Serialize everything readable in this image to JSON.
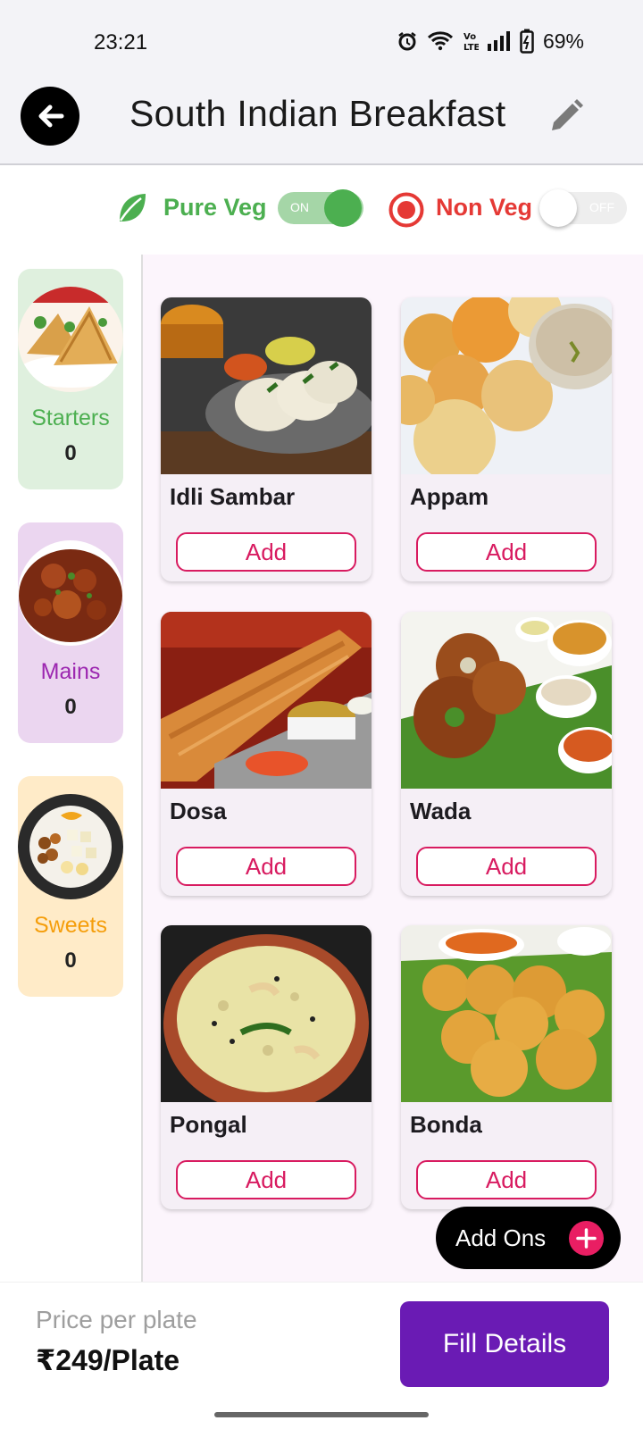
{
  "status_bar": {
    "time": "23:21",
    "battery": "69%"
  },
  "app_bar": {
    "title": "South Indian Breakfast"
  },
  "filters": {
    "veg": {
      "label": "Pure Veg",
      "state": "ON"
    },
    "nonveg": {
      "label": "Non Veg",
      "state": "OFF"
    }
  },
  "categories": [
    {
      "name": "Starters",
      "count": "0",
      "color": "#4caf50",
      "bg": "#dff0de"
    },
    {
      "name": "Mains",
      "count": "0",
      "color": "#9c27b0",
      "bg": "#ebd6f0"
    },
    {
      "name": "Sweets",
      "count": "0",
      "color": "#f59e0b",
      "bg": "#ffebc8"
    }
  ],
  "items": [
    {
      "name": "Idli Sambar",
      "add_label": "Add"
    },
    {
      "name": "Appam",
      "add_label": "Add"
    },
    {
      "name": "Dosa",
      "add_label": "Add"
    },
    {
      "name": "Wada",
      "add_label": "Add"
    },
    {
      "name": "Pongal",
      "add_label": "Add"
    },
    {
      "name": "Bonda",
      "add_label": "Add"
    }
  ],
  "add_ons": {
    "label": "Add Ons"
  },
  "footer": {
    "price_label": "Price per plate",
    "price_value": "₹249/Plate",
    "cta_label": "Fill Details"
  },
  "colors": {
    "accent": "#d81b60",
    "cta": "#6a1bb4",
    "veg": "#4caf50",
    "nonveg": "#e53935"
  }
}
